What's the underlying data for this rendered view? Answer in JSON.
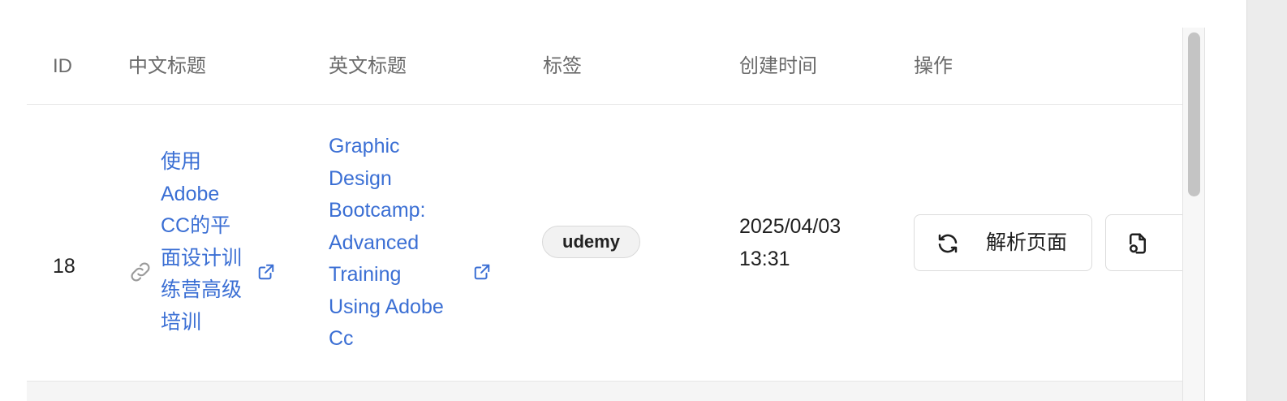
{
  "table": {
    "columns": [
      "ID",
      "中文标题",
      "英文标题",
      "标签",
      "创建时间",
      "操作"
    ],
    "rows": [
      {
        "id": "18",
        "zh_title_lines": [
          "使用",
          "Adobe",
          "CC的平",
          "面设计训",
          "练营高级",
          "培训"
        ],
        "en_title_lines": [
          "Graphic",
          "Design",
          "Bootcamp:",
          "Advanced",
          "Training",
          "Using Adobe",
          "Cc"
        ],
        "tag": "udemy",
        "created_lines": [
          "2025/04/03",
          "13:31"
        ],
        "actions": [
          {
            "label": "解析页面",
            "icon": "refresh-icon"
          },
          {
            "label": "",
            "icon": "document-icon"
          }
        ]
      }
    ]
  },
  "icons": {
    "link": "link-icon",
    "external": "external-link-icon"
  },
  "colors": {
    "link": "#3b6fd4",
    "header_text": "#6b6b6b",
    "border": "#e6e6e6"
  }
}
